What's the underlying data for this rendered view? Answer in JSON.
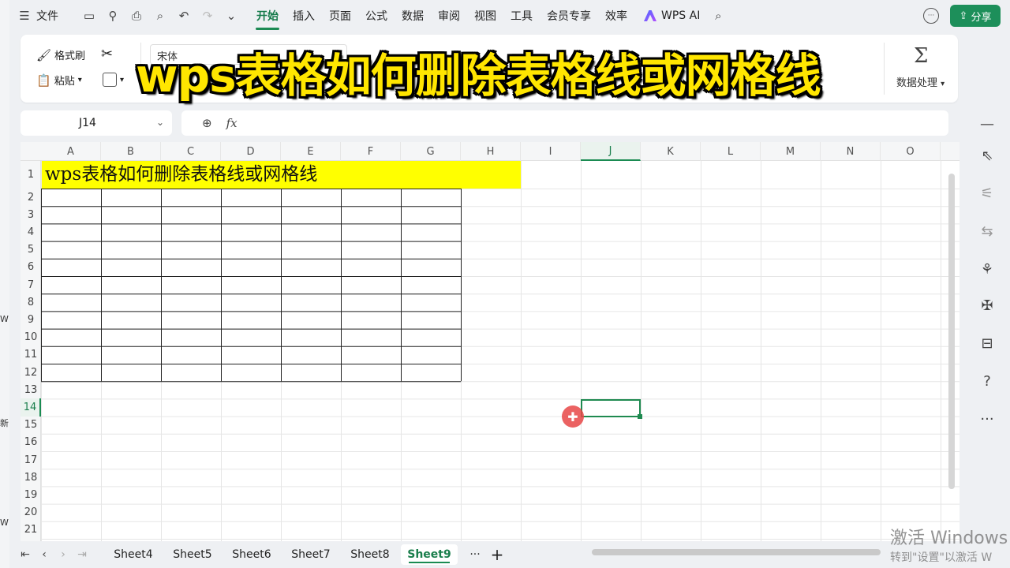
{
  "menubar": {
    "file_label": "文件",
    "menu_items": [
      "开始",
      "插入",
      "页面",
      "公式",
      "数据",
      "审阅",
      "视图",
      "工具",
      "会员专享",
      "效率"
    ],
    "active_menu": "开始",
    "wps_ai_label": "WPS AI",
    "share_label": "分享"
  },
  "ribbon": {
    "format_painter_label": "格式刷",
    "paste_label": "粘贴",
    "font_name": "宋体",
    "data_processing_label": "数据处理"
  },
  "overlay_title": "wps表格如何删除表格线或网格线",
  "formula_bar": {
    "name_box_value": "J14",
    "fx_label": "fx",
    "formula_value": ""
  },
  "grid": {
    "columns": [
      "A",
      "B",
      "C",
      "D",
      "E",
      "F",
      "G",
      "H",
      "I",
      "J",
      "K",
      "L",
      "M",
      "N",
      "O"
    ],
    "rows": [
      "1",
      "2",
      "3",
      "4",
      "5",
      "6",
      "7",
      "8",
      "9",
      "10",
      "11",
      "12",
      "13",
      "14",
      "15",
      "16",
      "17",
      "18",
      "19",
      "20",
      "21"
    ],
    "selected_column": "J",
    "selected_row": "14",
    "cell_A1_text": "wps表格如何删除表格线或网格线",
    "highlight_color": "#ffff00",
    "border_color": "#222222"
  },
  "sheets": {
    "tabs": [
      "Sheet4",
      "Sheet5",
      "Sheet6",
      "Sheet7",
      "Sheet8",
      "Sheet9"
    ],
    "active": "Sheet9",
    "more_label": "···",
    "add_label": "+"
  },
  "left_strip_chars": [
    "W",
    "新",
    "W"
  ],
  "watermark": {
    "line1": "激活 Windows",
    "line2": "转到\"设置\"以激活 W"
  },
  "colors": {
    "accent": "#1d8f5a",
    "title_yellow": "#ffe600"
  }
}
